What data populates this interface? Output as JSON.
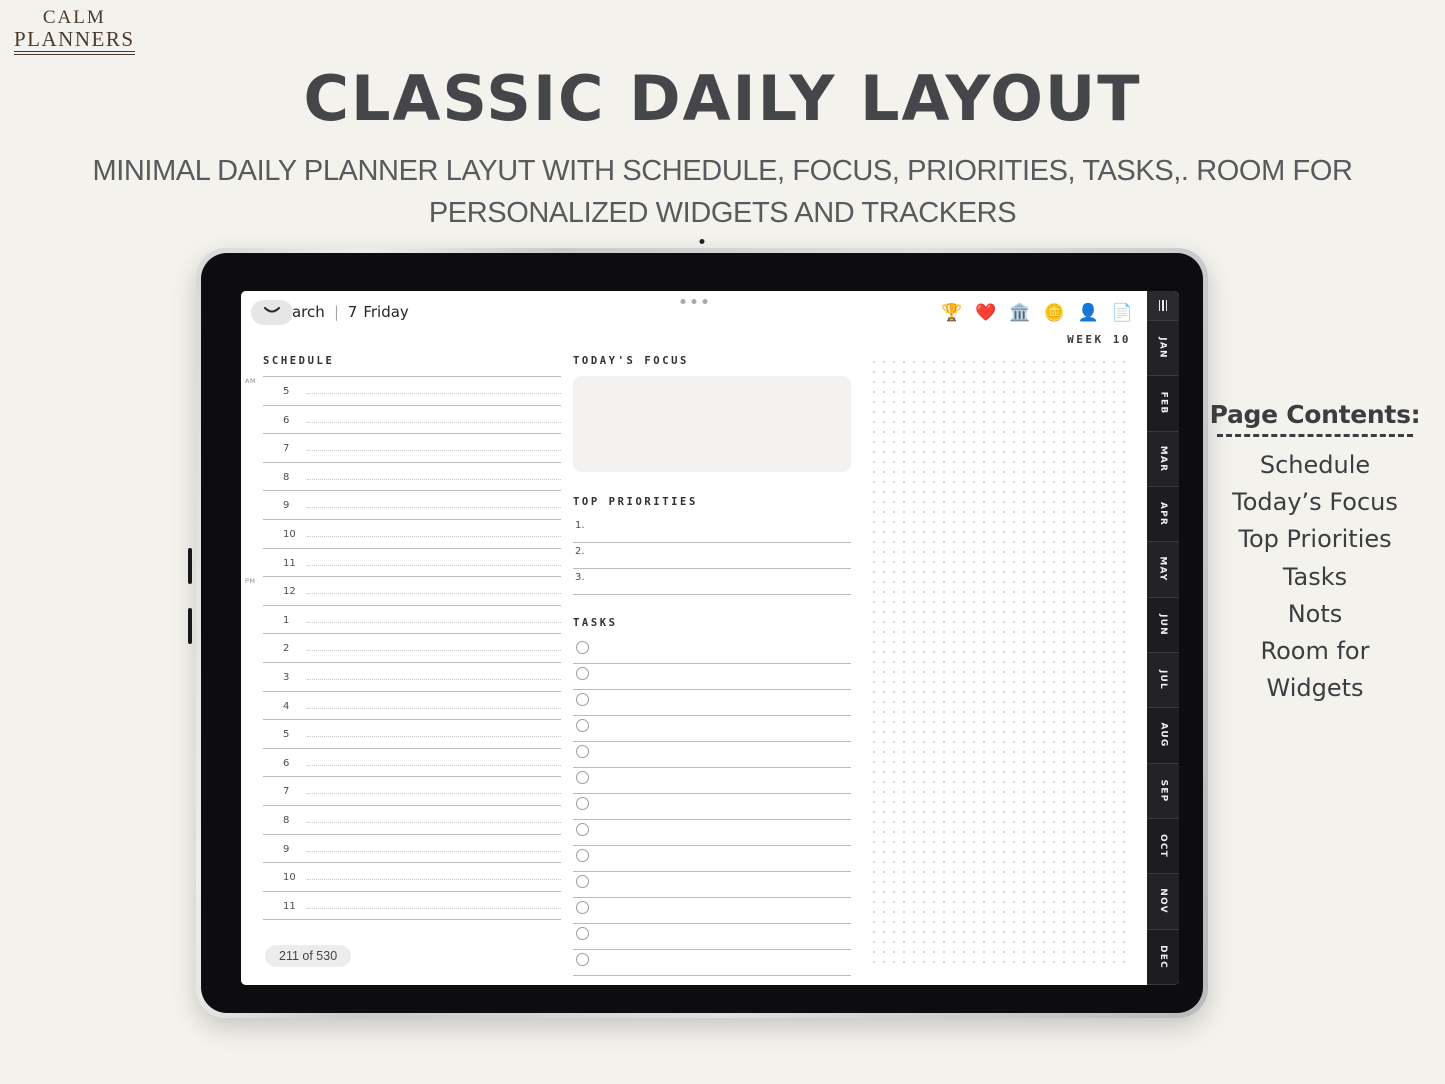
{
  "brand": {
    "line1": "CALM",
    "line2": "PLANNERS"
  },
  "headline": "Classic Daily Layout",
  "subheadline": "MINIMAL DAILY PLANNER LAYUT WITH SCHEDULE, FOCUS, PRIORITIES, TASKS,. ROOM FOR\nPERSONALIZED WIDGETS AND  TRACKERS",
  "planner": {
    "header": {
      "month": "March",
      "separator": "|",
      "day_number": "7",
      "day_name": "Friday",
      "chevron_icon": "chevron-down-icon",
      "icons": [
        {
          "name": "trophy-icon",
          "glyph": "🏆"
        },
        {
          "name": "heart-icon",
          "glyph": "❤️"
        },
        {
          "name": "bank-icon",
          "glyph": "🏛️"
        },
        {
          "name": "coin-icon",
          "glyph": "🪙"
        },
        {
          "name": "person-icon",
          "glyph": "👤"
        },
        {
          "name": "document-icon",
          "glyph": "📄"
        }
      ]
    },
    "week_label": "WEEK 10",
    "page_indicator": "211 of 530",
    "schedule": {
      "title": "SCHEDULE",
      "am_label": "AM",
      "pm_label": "PM",
      "am_hours": [
        "5",
        "6",
        "7",
        "8",
        "9",
        "10",
        "11"
      ],
      "pm_hours": [
        "12",
        "1",
        "2",
        "3",
        "4",
        "5",
        "6",
        "7",
        "8",
        "9",
        "10",
        "11"
      ]
    },
    "focus": {
      "title": "TODAY'S FOCUS",
      "value": ""
    },
    "priorities": {
      "title": "TOP PRIORITIES",
      "items": [
        "1.",
        "2.",
        "3."
      ]
    },
    "tasks": {
      "title": "TASKS",
      "count": 13
    },
    "month_tabs": [
      "JAN",
      "FEB",
      "MAR",
      "APR",
      "MAY",
      "JUN",
      "JUL",
      "AUG",
      "SEP",
      "OCT",
      "NOV",
      "DEC"
    ],
    "menu_icon": "hamburger-menu-icon"
  },
  "contents": {
    "title": "Page Contents:",
    "items": [
      "Schedule",
      "Today’s Focus",
      "Top Priorities",
      "Tasks",
      "Nots",
      "Room for",
      "Widgets"
    ]
  },
  "colors": {
    "background": "#f4f2ed",
    "headline": "#45464a",
    "brand": "#4a3a2c",
    "rail": "#1c1c1e",
    "focus_box": "#f3f2f0"
  }
}
